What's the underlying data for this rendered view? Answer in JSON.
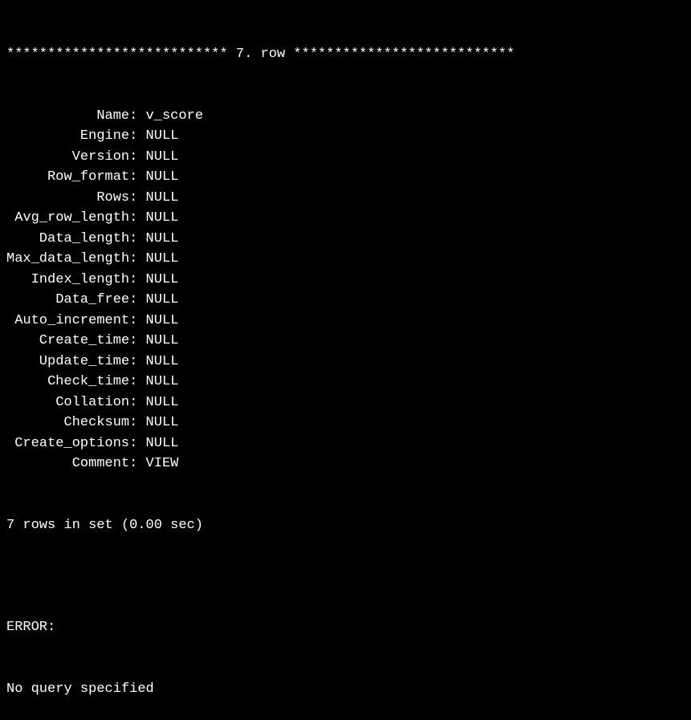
{
  "header": {
    "left_stars": "***************************",
    "row_label": " 7. row ",
    "right_stars": "***************************"
  },
  "fields": [
    {
      "label": "Name",
      "value": "v_score"
    },
    {
      "label": "Engine",
      "value": "NULL"
    },
    {
      "label": "Version",
      "value": "NULL"
    },
    {
      "label": "Row_format",
      "value": "NULL"
    },
    {
      "label": "Rows",
      "value": "NULL"
    },
    {
      "label": "Avg_row_length",
      "value": "NULL"
    },
    {
      "label": "Data_length",
      "value": "NULL"
    },
    {
      "label": "Max_data_length",
      "value": "NULL"
    },
    {
      "label": "Index_length",
      "value": "NULL"
    },
    {
      "label": "Data_free",
      "value": "NULL"
    },
    {
      "label": "Auto_increment",
      "value": "NULL"
    },
    {
      "label": "Create_time",
      "value": "NULL"
    },
    {
      "label": "Update_time",
      "value": "NULL"
    },
    {
      "label": "Check_time",
      "value": "NULL"
    },
    {
      "label": "Collation",
      "value": "NULL"
    },
    {
      "label": "Checksum",
      "value": "NULL"
    },
    {
      "label": "Create_options",
      "value": "NULL"
    },
    {
      "label": "Comment",
      "value": "VIEW"
    }
  ],
  "footer": {
    "summary": "7 rows in set (0.00 sec)",
    "blank": "",
    "error_label": "ERROR:",
    "error_message": "No query specified"
  },
  "separator": ": "
}
